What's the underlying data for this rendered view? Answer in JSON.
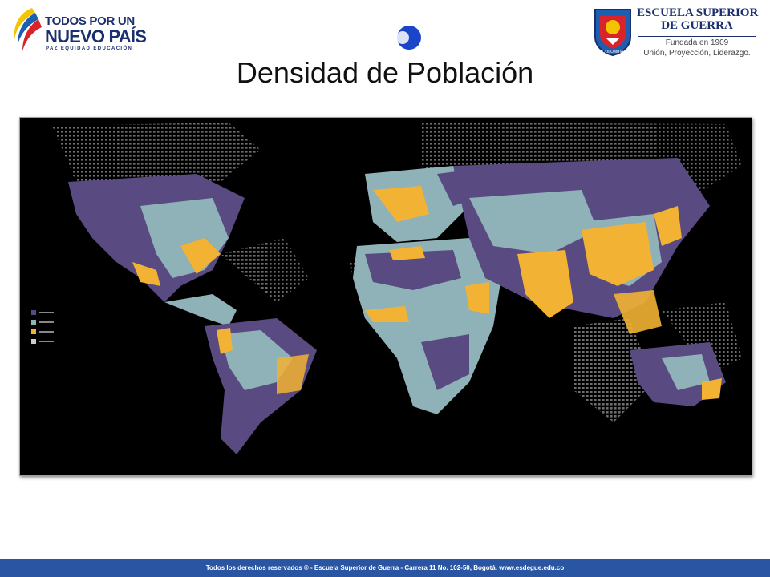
{
  "header": {
    "left_logo": {
      "line1": "TODOS POR UN",
      "line2": "NUEVO PAÍS",
      "tagline": "PAZ  EQUIDAD  EDUCACIÓN",
      "colors": [
        "#f5c400",
        "#1b5fb3",
        "#d8232a"
      ]
    },
    "right_logo": {
      "name_line1": "ESCUELA SUPERIOR",
      "name_line2": "DE GUERRA",
      "founded": "Fundada en 1909",
      "motto": "Unión, Proyección, Liderazgo.",
      "shield_text": "COLOMBIA"
    },
    "deco_color": "#1a45c8"
  },
  "slide": {
    "title": "Densidad de Población"
  },
  "map": {
    "background": "#000000",
    "colors": {
      "low": "#5a4a82",
      "medium": "#8fb2b8",
      "high": "#f2b233"
    }
  },
  "footer": {
    "text": "Todos los derechos reservados ® - Escuela Superior de Guerra - Carrera 11 No. 102-50, Bogotá. www.esdegue.edu.co",
    "color": "#2a55a3"
  }
}
